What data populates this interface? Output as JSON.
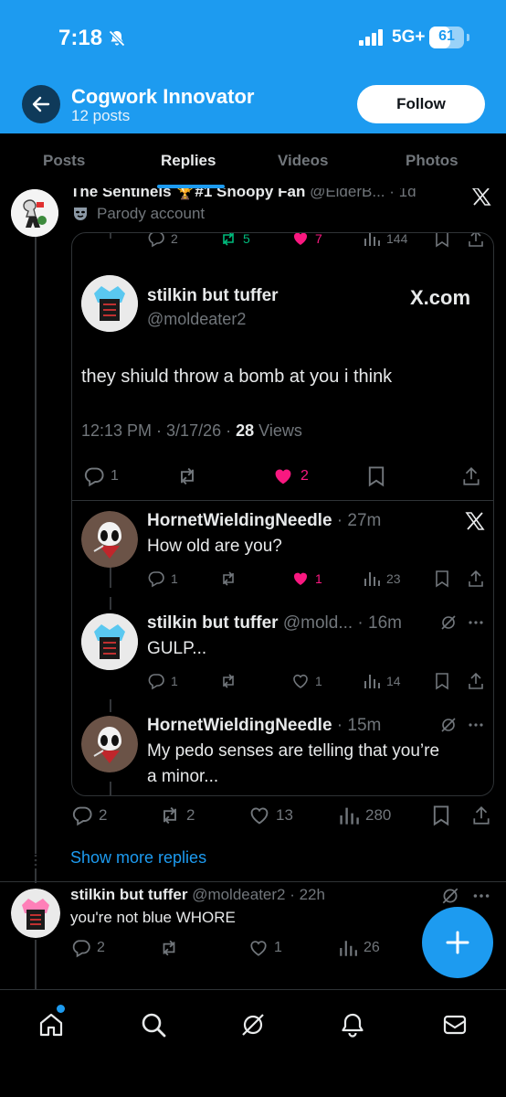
{
  "status_bar": {
    "time": "7:18",
    "network": "5G+",
    "battery": "61",
    "battery_level": 0.61
  },
  "header": {
    "title": "Cogwork Innovator",
    "posts_count": "12 posts",
    "follow_label": "Follow"
  },
  "tabs": [
    {
      "label": "Posts"
    },
    {
      "label": "Replies"
    },
    {
      "label": "Videos"
    },
    {
      "label": "Photos"
    }
  ],
  "parent_tweet": {
    "name": "The Sentinels 🏆#1 Snoopy Fan",
    "handle": "@ElderB...",
    "time": "· 1d",
    "badge_label": "Parody account"
  },
  "quote": {
    "stats_row": {
      "replies": "2",
      "retweets": "5",
      "likes": "7",
      "views": "144"
    },
    "author_name": "stilkin but tuffer",
    "author_handle": "@moldeater2",
    "brand": "X.com",
    "text": "they shiuld throw a bomb at  you i think",
    "time": "12:13 PM · 3/17/26 ·",
    "views_count": "28",
    "views_label": " Views",
    "replies": "1",
    "likes": "2",
    "comments": [
      {
        "name": "HornetWieldingNeedle",
        "meta": "· 27m",
        "text": "How old are you?",
        "replies": "1",
        "retweets": "",
        "likes": "1",
        "views": "23"
      },
      {
        "name": "stilkin but tuffer",
        "meta": "@mold... · 16m",
        "text": "GULP...",
        "replies": "1",
        "retweets": "",
        "likes": "1",
        "views": "14"
      },
      {
        "name": "HornetWieldingNeedle",
        "meta": "· 15m",
        "text_line1": "My pedo senses are telling that you’re",
        "text_line2": "a minor..."
      }
    ]
  },
  "parent_actions": {
    "replies": "2",
    "retweets": "2",
    "likes": "13",
    "views": "280"
  },
  "show_more": "Show more replies",
  "reply_tweet": {
    "name": "stilkin but tuffer",
    "meta": "@moldeater2 · 22h",
    "text": "you're not blue WHORE",
    "replies": "2",
    "likes": "1",
    "views": "26"
  },
  "colors": {
    "accent": "#1d9bf0",
    "like_pink": "#f91880",
    "retweet_green": "#00ba7c",
    "muted": "#71767b"
  }
}
